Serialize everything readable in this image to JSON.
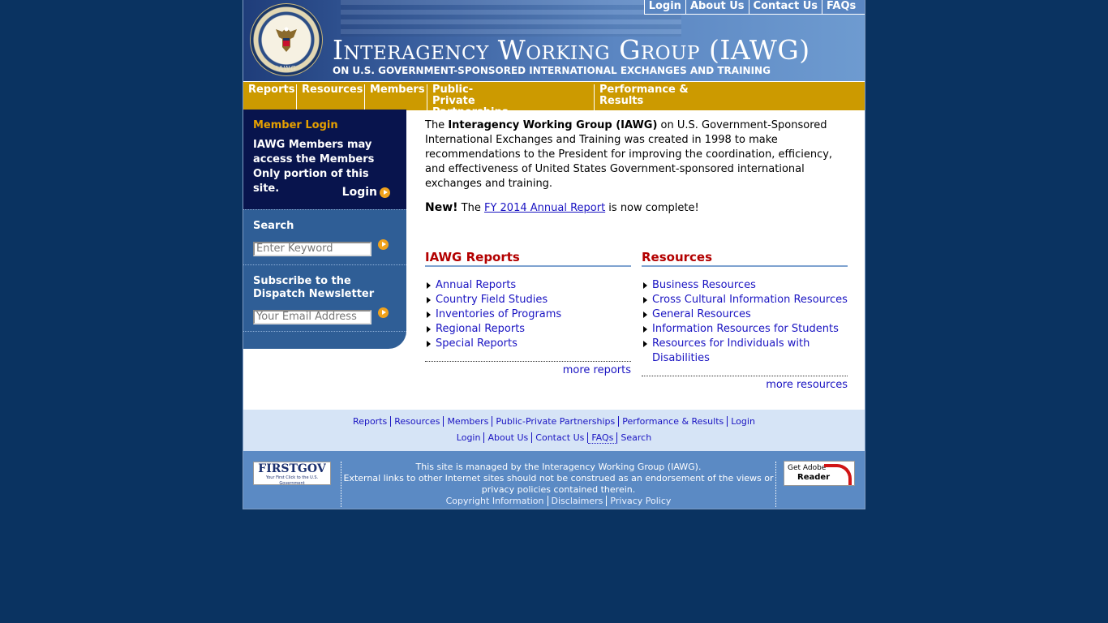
{
  "header": {
    "title": "Interagency Working Group (IAWG)",
    "subtitle": "ON U.S. GOVERNMENT-SPONSORED INTERNATIONAL EXCHANGES AND TRAINING",
    "seal_text": "IAWG",
    "top_links": [
      "Login",
      "About Us",
      "Contact Us",
      "FAQs"
    ]
  },
  "nav": {
    "items": [
      "Reports",
      "Resources",
      "Members",
      "Public-Private Partnerships",
      "Performance & Results"
    ]
  },
  "sidebar": {
    "login": {
      "heading": "Member Login",
      "text": "IAWG Members may access the Members Only portion of this site.",
      "link": "Login"
    },
    "search": {
      "heading": "Search",
      "placeholder": "Enter Keyword"
    },
    "newsletter": {
      "heading": "Subscribe to the Dispatch Newsletter",
      "placeholder": "Your Email Address"
    }
  },
  "main": {
    "intro_prefix": "The ",
    "intro_bold": "Interagency Working Group (IAWG)",
    "intro_rest": " on U.S. Government-Sponsored International Exchanges and Training was created in 1998 to make recommendations to the President for improving the coordination, efficiency, and effectiveness of United States Government-sponsored international exchanges and training.",
    "new_label": "New!",
    "new_prefix": " The ",
    "new_link": "FY 2014 Annual Report",
    "new_suffix": " is now complete!",
    "reports": {
      "heading": "IAWG Reports",
      "items": [
        "Annual Reports",
        "Country Field Studies",
        "Inventories of Programs",
        "Regional Reports",
        "Special Reports"
      ],
      "more": "more reports"
    },
    "resources": {
      "heading": "Resources",
      "items": [
        "Business Resources",
        "Cross Cultural Information Resources",
        "General Resources",
        "Information Resources for Students",
        "Resources for Individuals with Disabilities"
      ],
      "more": "more resources"
    }
  },
  "footer_nav": {
    "row1": [
      "Reports",
      "Resources",
      "Members",
      "Public-Private Partnerships",
      "Performance & Results",
      "Login"
    ],
    "row2": [
      "Login",
      "About Us",
      "Contact Us",
      "FAQs",
      "Search"
    ]
  },
  "footer": {
    "firstgov_logo": "FIRSTGOV",
    "firstgov_tagline": "Your First Click to the U.S. Government",
    "line1": "This site is managed by the Interagency Working Group (IAWG).",
    "line2": "External links to other Internet sites should not be construed as an endorsement of the views or privacy policies contained therein.",
    "links": [
      "Copyright Information",
      "Disclaimers",
      "Privacy Policy"
    ],
    "adobe_line1": "Get Adobe",
    "adobe_line2": "Reader"
  }
}
